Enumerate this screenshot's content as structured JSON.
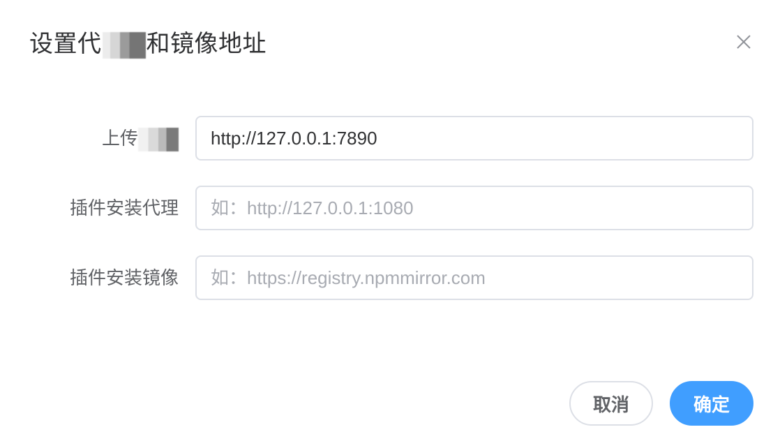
{
  "dialog": {
    "title_prefix": "设置",
    "title_partial": "代",
    "title_suffix": "和镜像地址",
    "close_icon": "close-icon"
  },
  "form": {
    "fields": [
      {
        "label": "上传",
        "value": "http://127.0.0.1:7890",
        "placeholder": ""
      },
      {
        "label": "插件安装代理",
        "value": "",
        "placeholder": "如：http://127.0.0.1:1080"
      },
      {
        "label": "插件安装镜像",
        "value": "",
        "placeholder": "如：https://registry.npmmirror.com"
      }
    ]
  },
  "footer": {
    "cancel_label": "取消",
    "confirm_label": "确定"
  },
  "colors": {
    "primary": "#409eff",
    "border": "#dcdfe6",
    "label": "#606266",
    "placeholder": "#a8abb2"
  }
}
